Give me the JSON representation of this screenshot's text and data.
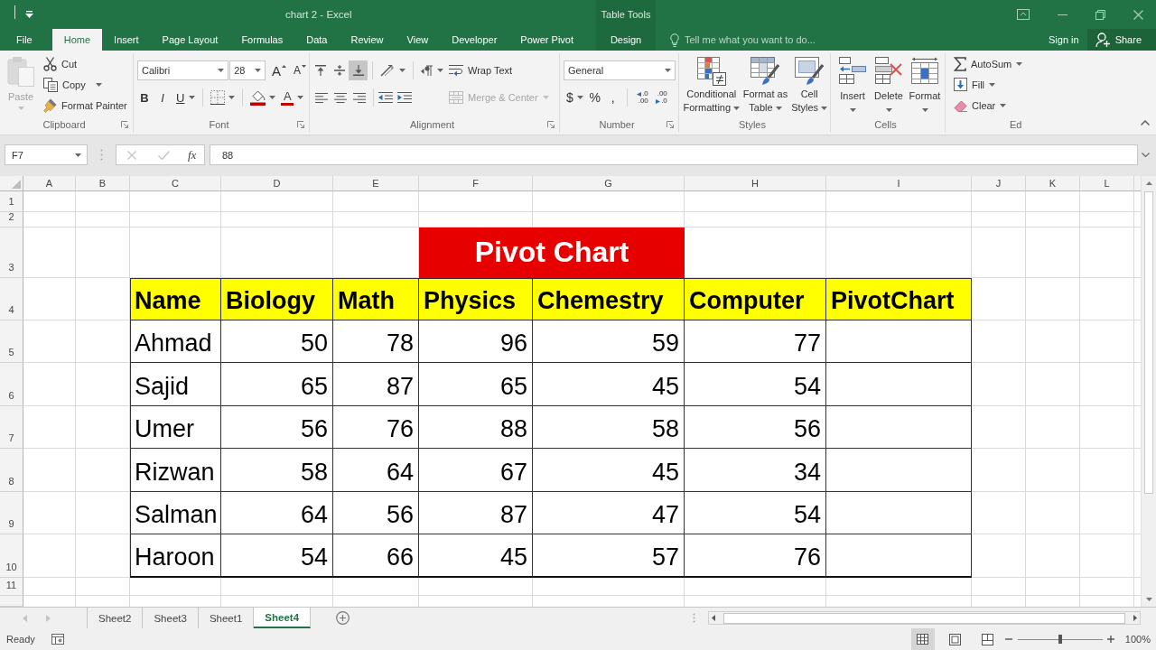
{
  "window": {
    "title": "chart 2 - Excel",
    "context_group": "Table Tools"
  },
  "tabs": [
    {
      "label": "File",
      "selected": false,
      "kind": "tab"
    },
    {
      "label": "Home",
      "selected": true,
      "kind": "tab"
    },
    {
      "label": "Insert",
      "selected": false,
      "kind": "tab"
    },
    {
      "label": "Page Layout",
      "selected": false,
      "kind": "tab"
    },
    {
      "label": "Formulas",
      "selected": false,
      "kind": "tab"
    },
    {
      "label": "Data",
      "selected": false,
      "kind": "tab"
    },
    {
      "label": "Review",
      "selected": false,
      "kind": "tab"
    },
    {
      "label": "View",
      "selected": false,
      "kind": "tab"
    },
    {
      "label": "Developer",
      "selected": false,
      "kind": "tab"
    },
    {
      "label": "Power Pivot",
      "selected": false,
      "kind": "tab"
    },
    {
      "label": "Design",
      "selected": false,
      "kind": "context"
    }
  ],
  "tell_me": {
    "placeholder": "Tell me what you want to do..."
  },
  "account": {
    "sign_in": "Sign in",
    "share": "Share"
  },
  "ribbon": {
    "clipboard": {
      "label": "Clipboard",
      "paste": {
        "label": "Paste",
        "disabled": true
      },
      "cut": "Cut",
      "copy": "Copy",
      "format_painter": "Format Painter"
    },
    "font": {
      "label": "Font",
      "font_name": "Calibri",
      "font_size": "28",
      "grow": "A",
      "shrink": "A",
      "bold": "B",
      "italic": "I",
      "underline": "U",
      "font_color": "A"
    },
    "alignment": {
      "label": "Alignment",
      "vertical": [
        {
          "kind": "top",
          "selected": false
        },
        {
          "kind": "middle",
          "selected": false
        },
        {
          "kind": "bottom",
          "selected": true
        }
      ],
      "horizontal": [
        {
          "kind": "left",
          "selected": false
        },
        {
          "kind": "center",
          "selected": false
        },
        {
          "kind": "right",
          "selected": false
        }
      ],
      "wrap_text": "Wrap Text",
      "merge_center": {
        "label": "Merge & Center",
        "disabled": true
      }
    },
    "number": {
      "label": "Number",
      "format": "General",
      "symbols": [
        {
          "label": "$",
          "menu": true
        },
        {
          "label": "%",
          "menu": false
        },
        {
          "label": ",",
          "menu": false
        }
      ],
      "decimals": [
        {
          "kind": "increase",
          "top": ".0",
          "bottom": ".00"
        },
        {
          "kind": "decrease",
          "top": ".00",
          "bottom": ".0"
        }
      ]
    },
    "styles": {
      "label": "Styles",
      "buttons": [
        {
          "kind": "conditional",
          "label": "Conditional Formatting"
        },
        {
          "kind": "table",
          "label": "Format as Table"
        },
        {
          "kind": "cell_styles",
          "label": "Cell Styles"
        }
      ]
    },
    "cells": {
      "label": "Cells",
      "buttons": [
        {
          "kind": "insert",
          "label": "Insert"
        },
        {
          "kind": "delete",
          "label": "Delete"
        },
        {
          "kind": "format",
          "label": "Format"
        }
      ]
    },
    "editing": {
      "label": "Ed",
      "buttons": [
        {
          "kind": "autosum",
          "label": "AutoSum"
        },
        {
          "kind": "fill",
          "label": "Fill"
        },
        {
          "kind": "clear",
          "label": "Clear"
        }
      ]
    }
  },
  "formula_bar": {
    "name_box": "F7",
    "fx": "fx",
    "value": "88"
  },
  "sheet": {
    "columns": [
      "A",
      "B",
      "C",
      "D",
      "E",
      "F",
      "G",
      "H",
      "I",
      "J",
      "K",
      "L"
    ],
    "rows": [
      "1",
      "2",
      "3",
      "4",
      "5",
      "6",
      "7",
      "8",
      "9",
      "10",
      "11"
    ],
    "title": "Pivot Chart",
    "table": {
      "columns": [
        "Name",
        "Biology",
        "Math",
        "Physics",
        "Chemestry",
        "Computer",
        "PivotChart"
      ],
      "rows": [
        [
          "Ahmad",
          "50",
          "78",
          "96",
          "59",
          "77"
        ],
        [
          "Sajid",
          "65",
          "87",
          "65",
          "45",
          "54"
        ],
        [
          "Umer",
          "56",
          "76",
          "88",
          "58",
          "56"
        ],
        [
          "Rizwan",
          "58",
          "64",
          "67",
          "45",
          "34"
        ],
        [
          "Salman",
          "64",
          "56",
          "87",
          "47",
          "54"
        ],
        [
          "Haroon",
          "54",
          "66",
          "45",
          "57",
          "76"
        ]
      ]
    }
  },
  "sheet_tabs": [
    {
      "label": "Sheet2",
      "selected": false
    },
    {
      "label": "Sheet3",
      "selected": false
    },
    {
      "label": "Sheet1",
      "selected": false
    },
    {
      "label": "Sheet4",
      "selected": true
    }
  ],
  "status_bar": {
    "status": "Ready",
    "views": [
      {
        "kind": "normal",
        "selected": true
      },
      {
        "kind": "page_layout",
        "selected": false
      },
      {
        "kind": "page_break",
        "selected": false
      }
    ],
    "zoom": {
      "level": 0.5,
      "reading": "100%"
    }
  }
}
